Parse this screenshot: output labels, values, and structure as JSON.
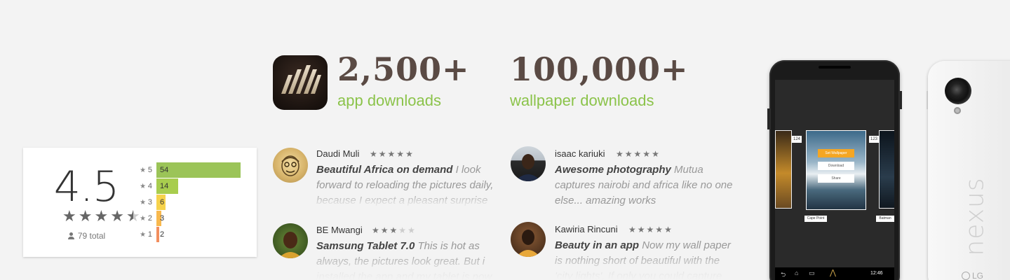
{
  "rating": {
    "score": "4.5",
    "total": "79 total",
    "histogram": [
      {
        "stars": "5",
        "count": "54",
        "value": 54,
        "color": "#9bc458"
      },
      {
        "stars": "4",
        "count": "14",
        "value": 14,
        "color": "#a8cd4e"
      },
      {
        "stars": "3",
        "count": "6",
        "value": 6,
        "color": "#f6d24b"
      },
      {
        "stars": "2",
        "count": "3",
        "value": 3,
        "color": "#f8b84d"
      },
      {
        "stars": "1",
        "count": "2",
        "value": 2,
        "color": "#f28e5e"
      }
    ],
    "star_value": 4.5
  },
  "stats": {
    "app_downloads": {
      "number": "2,500+",
      "label": "app downloads"
    },
    "wallpaper_downloads": {
      "number": "100,000+",
      "label": "wallpaper downloads"
    }
  },
  "colors": {
    "accent_green": "#8bc34a",
    "stat_brown": "#5a4a44"
  },
  "reviews": [
    {
      "name": "Daudi Muli",
      "stars": 5,
      "title": "Beautiful Africa on demand",
      "text": " I look forward to reloading the pictures daily, because I expect a pleasant surprise"
    },
    {
      "name": "isaac kariuki",
      "stars": 5,
      "title": "Awesome photography",
      "text": " Mutua captures nairobi and africa like no one else... amazing works"
    },
    {
      "name": "BE Mwangi",
      "stars": 3,
      "title": "Samsung Tablet 7.0",
      "text": " This is hot as always, the pictures look great. But i installed the app and my tablet is now"
    },
    {
      "name": "Kawiria Rincuni",
      "stars": 5,
      "title": "Beauty in an app",
      "text": " Now my wall paper is nothing short of beautiful with the 'city lights'. If only you could capture"
    }
  ],
  "phone_screen": {
    "buttons": [
      "Set Wallpaper",
      "Download",
      "Share"
    ],
    "left_count": "124",
    "right_count": "123",
    "left_caption": "Cape Point",
    "right_caption": "Batman",
    "time": "12:46"
  },
  "device": {
    "brand_text": "nexus",
    "maker": "LG"
  }
}
